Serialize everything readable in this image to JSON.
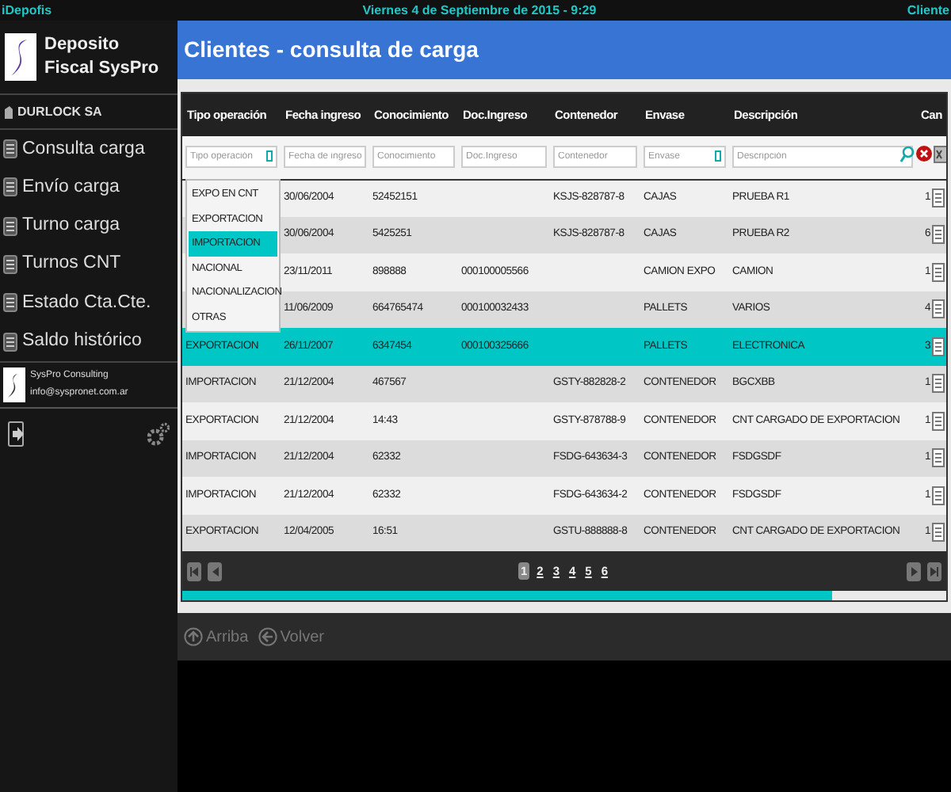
{
  "status_bar": {
    "app": "iDepofis",
    "datetime": "Viernes 4 de Septiembre de 2015 - 9:29",
    "section": "Cliente"
  },
  "sidebar": {
    "brand": "Deposito Fiscal SysPro",
    "company": "DURLOCK SA",
    "items": [
      {
        "label": "Consulta carga"
      },
      {
        "label": "Envío carga"
      },
      {
        "label": "Turno carga"
      },
      {
        "label": "Turnos CNT"
      },
      {
        "label": "Estado Cta.Cte."
      },
      {
        "label": "Saldo histórico"
      }
    ],
    "footer": {
      "name": "SysPro Consulting",
      "email": "info@syspronet.com.ar"
    }
  },
  "page_title": "Clientes - consulta de carga",
  "table": {
    "columns": [
      "Tipo operación",
      "Fecha ingreso",
      "Conocimiento",
      "Doc.Ingreso",
      "Contenedor",
      "Envase",
      "Descripción",
      "Can"
    ],
    "filters": [
      {
        "placeholder": "Tipo operación",
        "kind": "select"
      },
      {
        "placeholder": "Fecha de ingreso",
        "kind": "text"
      },
      {
        "placeholder": "Conocimiento",
        "kind": "text"
      },
      {
        "placeholder": "Doc.Ingreso",
        "kind": "text"
      },
      {
        "placeholder": "Contenedor",
        "kind": "text"
      },
      {
        "placeholder": "Envase",
        "kind": "select"
      },
      {
        "placeholder": "Descripción",
        "kind": "text"
      }
    ],
    "rows": [
      {
        "selected": false,
        "cells": [
          null,
          "30/06/2004",
          "52452151",
          null,
          "KSJS-828787-8",
          "CAJAS",
          "PRUEBA R1",
          "1"
        ]
      },
      {
        "selected": false,
        "cells": [
          null,
          "30/06/2004",
          "5425251",
          null,
          "KSJS-828787-8",
          "CAJAS",
          "PRUEBA R2",
          "6"
        ]
      },
      {
        "selected": false,
        "cells": [
          null,
          "23/11/2011",
          "898888",
          "000100005566",
          null,
          "CAMION EXPO",
          "CAMION",
          "1"
        ]
      },
      {
        "selected": false,
        "cells": [
          null,
          "11/06/2009",
          "664765474",
          "000100032433",
          null,
          "PALLETS",
          "VARIOS",
          "4"
        ]
      },
      {
        "selected": true,
        "cells": [
          "EXPORTACION",
          "26/11/2007",
          "6347454",
          "000100325666",
          null,
          "PALLETS",
          "ELECTRONICA",
          "3"
        ]
      },
      {
        "selected": false,
        "cells": [
          "IMPORTACION",
          "21/12/2004",
          "467567",
          null,
          "GSTY-882828-2",
          "CONTENEDOR",
          "BGCXBB",
          "1"
        ]
      },
      {
        "selected": false,
        "cells": [
          "EXPORTACION",
          "21/12/2004",
          "14:43",
          null,
          "GSTY-878788-9",
          "CONTENEDOR",
          "CNT CARGADO DE EXPORTACION",
          "1"
        ]
      },
      {
        "selected": false,
        "cells": [
          "IMPORTACION",
          "21/12/2004",
          "62332",
          null,
          "FSDG-643634-3",
          "CONTENEDOR",
          "FSDGSDF",
          "1"
        ]
      },
      {
        "selected": false,
        "cells": [
          "IMPORTACION",
          "21/12/2004",
          "62332",
          null,
          "FSDG-643634-2",
          "CONTENEDOR",
          "FSDGSDF",
          "1"
        ]
      },
      {
        "selected": false,
        "cells": [
          "EXPORTACION",
          "12/04/2005",
          "16:51",
          null,
          "GSTU-888888-8",
          "CONTENEDOR",
          "CNT CARGADO DE EXPORTACION",
          "1"
        ]
      }
    ],
    "dropdown": {
      "options": [
        {
          "label": "EXPO EN CNT",
          "selected": false
        },
        {
          "label": "EXPORTACION",
          "selected": false
        },
        {
          "label": "IMPORTACION",
          "selected": true
        },
        {
          "label": "NACIONAL",
          "selected": false
        },
        {
          "label": "NACIONALIZACION",
          "selected": false
        },
        {
          "label": "OTRAS",
          "selected": false
        }
      ]
    }
  },
  "pager": {
    "pages": [
      {
        "label": "1",
        "selected": true
      },
      {
        "label": "2",
        "selected": false
      },
      {
        "label": "3",
        "selected": false
      },
      {
        "label": "4",
        "selected": false
      },
      {
        "label": "5",
        "selected": false
      },
      {
        "label": "6",
        "selected": false
      }
    ]
  },
  "progress": {
    "level": 0.85
  },
  "nav_buttons": [
    {
      "label": "Arriba",
      "disabled": true
    },
    {
      "label": "Volver",
      "disabled": true
    }
  ]
}
